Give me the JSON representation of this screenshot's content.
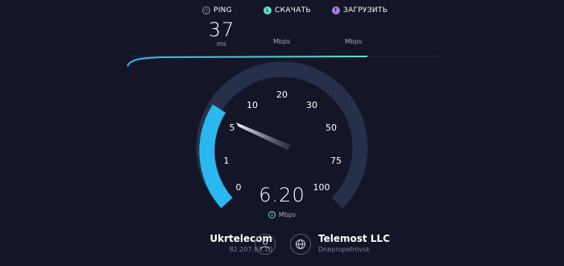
{
  "header": {
    "ping": {
      "label": "PING",
      "icon": "ping-icon",
      "value": "37",
      "unit": "ms"
    },
    "download": {
      "label": "СКАЧАТЬ",
      "icon": "download-arrow-icon",
      "unit": "Mbps"
    },
    "upload": {
      "label": "ЗАГРУЗИТЬ",
      "icon": "upload-arrow-icon",
      "unit": "Mbps"
    }
  },
  "gauge": {
    "ticks": [
      "0",
      "1",
      "5",
      "10",
      "20",
      "30",
      "50",
      "75",
      "100"
    ],
    "current_value": "6.20",
    "current_unit": "Mbps",
    "max_value": 100
  },
  "isp": {
    "name": "Ukrtelecom",
    "ip": "82.207.94.10"
  },
  "server": {
    "name": "Telemost LLC",
    "location": "Dnepropetrovsk"
  },
  "colors": {
    "background": "#141526",
    "download": "#5fe2c1",
    "upload": "#a77be0",
    "gauge_fill": "#2bb8f0",
    "gauge_track": "#27304a"
  }
}
